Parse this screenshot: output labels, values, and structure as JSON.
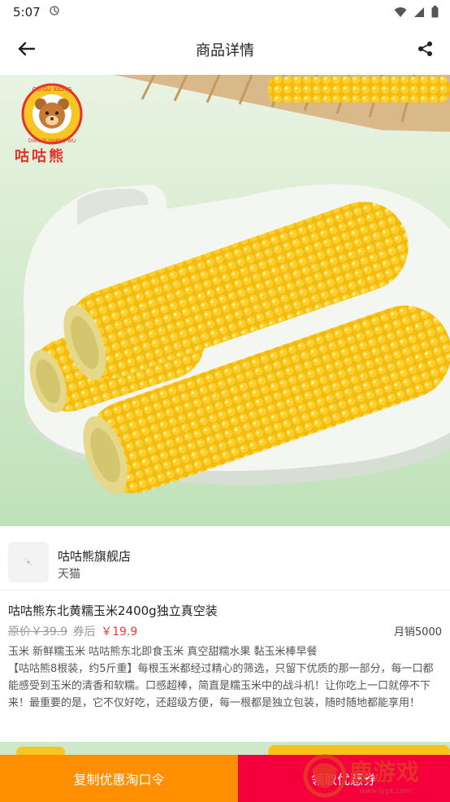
{
  "status_bar": {
    "time": "5:07",
    "app_icon": "notification-app-icon",
    "wifi_icon": "wifi-icon",
    "signal_icon": "signal-icon",
    "battery_icon": "battery-icon"
  },
  "nav": {
    "title": "商品详情",
    "back_icon": "back-arrow-icon",
    "share_icon": "share-icon"
  },
  "hero": {
    "brand_logo_text": "咕咕熊",
    "brand_logo_ring_text": "GU GU XIONG · DIAN ZI SHANG WU"
  },
  "store": {
    "name": "咕咕熊旗舰店",
    "platform": "天猫"
  },
  "product": {
    "title": "咕咕熊东北黄糯玉米2400g独立真空装",
    "original_price_label": "原价￥39.9",
    "after_coupon_label": "券后",
    "after_coupon_price": "￥19.9",
    "monthly_sales": "月销5000",
    "keywords": "玉米 新鲜糯玉米 咕咕熊东北即食玉米 真空甜糯水果 黏玉米棒早餐",
    "description": "【咕咕熊8根装，约5斤重】每根玉米都经过精心的筛选，只留下优质的那一部分，每一口都能感受到玉米的清香和软糯。口感超棒，简直是糯玉米中的战斗机！让你吃上一口就停不下来！最重要的是，它不仅好吃，还超级方便，每一根都是独立包装，随时随地都能享用！"
  },
  "actions": {
    "copy_label": "复制优惠淘口令",
    "coupon_label": "领取优惠券"
  },
  "watermark": {
    "text": "鹿游戏",
    "url": "www.lyyx.com"
  },
  "colors": {
    "price_red": "#f23b30",
    "copy_orange": "#ff8f00",
    "coupon_red": "#f5003d",
    "corn_yellow": "#f7c21a"
  }
}
